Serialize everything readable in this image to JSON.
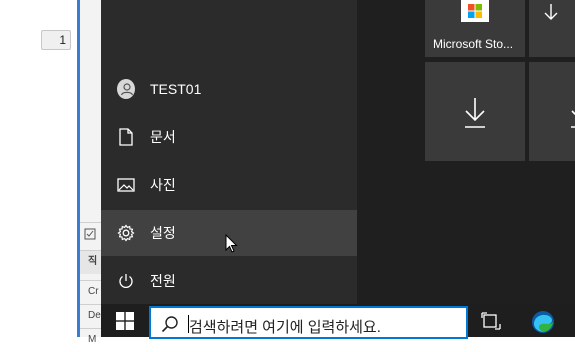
{
  "background_app": {
    "stepper_value": "1",
    "panel_rows": [
      "직",
      "Cr",
      "De",
      "M"
    ]
  },
  "start_menu": {
    "items": [
      {
        "label": "TEST01",
        "icon": "user-avatar-icon"
      },
      {
        "label": "문서",
        "icon": "document-icon"
      },
      {
        "label": "사진",
        "icon": "pictures-icon"
      },
      {
        "label": "설정",
        "icon": "gear-icon"
      },
      {
        "label": "전원",
        "icon": "power-icon"
      }
    ],
    "hovered_item": "설정"
  },
  "tiles": {
    "store_label": "Microsoft Sto...",
    "download_icon": "download-arrow-icon"
  },
  "taskbar": {
    "search_placeholder": "검색하려면 여기에 입력하세요.",
    "icons": [
      "windows-logo-icon",
      "search-icon",
      "task-view-icon",
      "edge-browser-icon"
    ]
  },
  "colors": {
    "start_menu_bg": "#2b2b2b",
    "hover_bg": "#414141",
    "tile_bg": "#3a3a3a",
    "taskbar_bg": "#1e1e1e",
    "accent_blue": "#0078d7"
  }
}
